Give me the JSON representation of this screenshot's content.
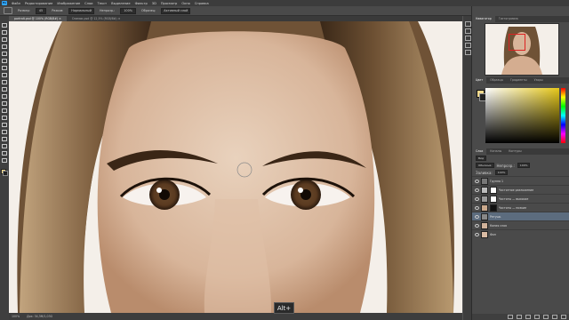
{
  "menu": [
    "Файл",
    "Редактирование",
    "Изображение",
    "Слои",
    "Текст",
    "Выделение",
    "Фильтр",
    "3D",
    "Просмотр",
    "Окно",
    "Справка"
  ],
  "options": {
    "label_size": "Размер:",
    "size_value": "45",
    "label_mode": "Режим:",
    "mode_value": "Нормальный",
    "label_opacity": "Непрозр.:",
    "opacity_value": "100%",
    "label_sample": "Образец:",
    "sample_value": "Активный слой"
  },
  "tabs": [
    {
      "label": "portrait.psd @ 100% (RGB/8#) ×"
    },
    {
      "label": "Снимок.psd @ 12,5% (RGB/8#) ×"
    }
  ],
  "tooltip": "Alt+",
  "status": {
    "zoom": "100%",
    "doc": "Док: 34,3M/1,03G"
  },
  "navigator": {
    "tab1": "Навигатор",
    "tab2": "Гистограмма"
  },
  "color": {
    "tab1": "Цвет",
    "tab2": "Образцы",
    "tab3": "Градиенты",
    "tab4": "Узоры",
    "fg": "#f2d98c",
    "hue": "#e6c81a"
  },
  "layers": {
    "tab1": "Слои",
    "tab2": "Каналы",
    "tab3": "Контуры",
    "kind": "Вид",
    "mode": "Обычные",
    "opacity_label": "Непрозр.:",
    "opacity": "100%",
    "fill_label": "Заливка:",
    "fill": "100%",
    "items": [
      {
        "name": "Группа 1"
      },
      {
        "name": "Частотное разложение"
      },
      {
        "name": "Частоты — высокие"
      },
      {
        "name": "Частоты — низкие"
      },
      {
        "name": "Ретушь"
      },
      {
        "name": "Копия слоя"
      },
      {
        "name": "Фон"
      }
    ]
  }
}
